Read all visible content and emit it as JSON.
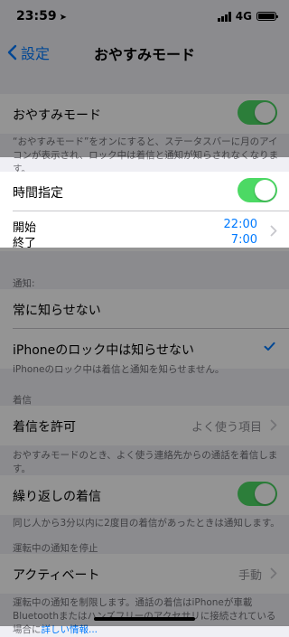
{
  "status": {
    "time": "23:59",
    "network": "4G"
  },
  "nav": {
    "back_label": "設定",
    "title": "おやすみモード"
  },
  "dnd": {
    "label": "おやすみモード",
    "enabled": true,
    "footnote": "“おやすみモード”をオンにすると、ステータスバーに月のアイコンが表示され、ロック中は着信と通知が知らされなくなります。"
  },
  "scheduled": {
    "label": "時間指定",
    "enabled": true,
    "start_label": "開始",
    "start_time": "22:00",
    "end_label": "終了",
    "end_time": "7:00"
  },
  "silence": {
    "header": "通知:",
    "options": [
      "常に知らせない",
      "iPhoneのロック中は知らせない"
    ],
    "selected_index": 1,
    "footnote": "iPhoneのロック中は着信と通知を知らせません。"
  },
  "phone": {
    "header": "着信",
    "allow_calls_label": "着信を許可",
    "allow_calls_value": "よく使う項目",
    "footnote": "おやすみモードのとき、よく使う連絡先からの通話を着信します。",
    "repeated_label": "繰り返しの着信",
    "repeated_enabled": true,
    "repeated_footnote": "同じ人から3分以内に2度目の着信があったときは通知します。"
  },
  "driving": {
    "header": "運転中の通知を停止",
    "activate_label": "アクティベート",
    "activate_value": "手動",
    "footnote": "運転中の通知を制限します。通話の着信はiPhoneが車載Bluetoothまたはハンズフリーのアクセサリに接続されている場合に",
    "footnote_link": "詳しい情報..."
  },
  "colors": {
    "accent": "#007aff",
    "toggle_on": "#4cd964",
    "background": "#efeff4"
  }
}
